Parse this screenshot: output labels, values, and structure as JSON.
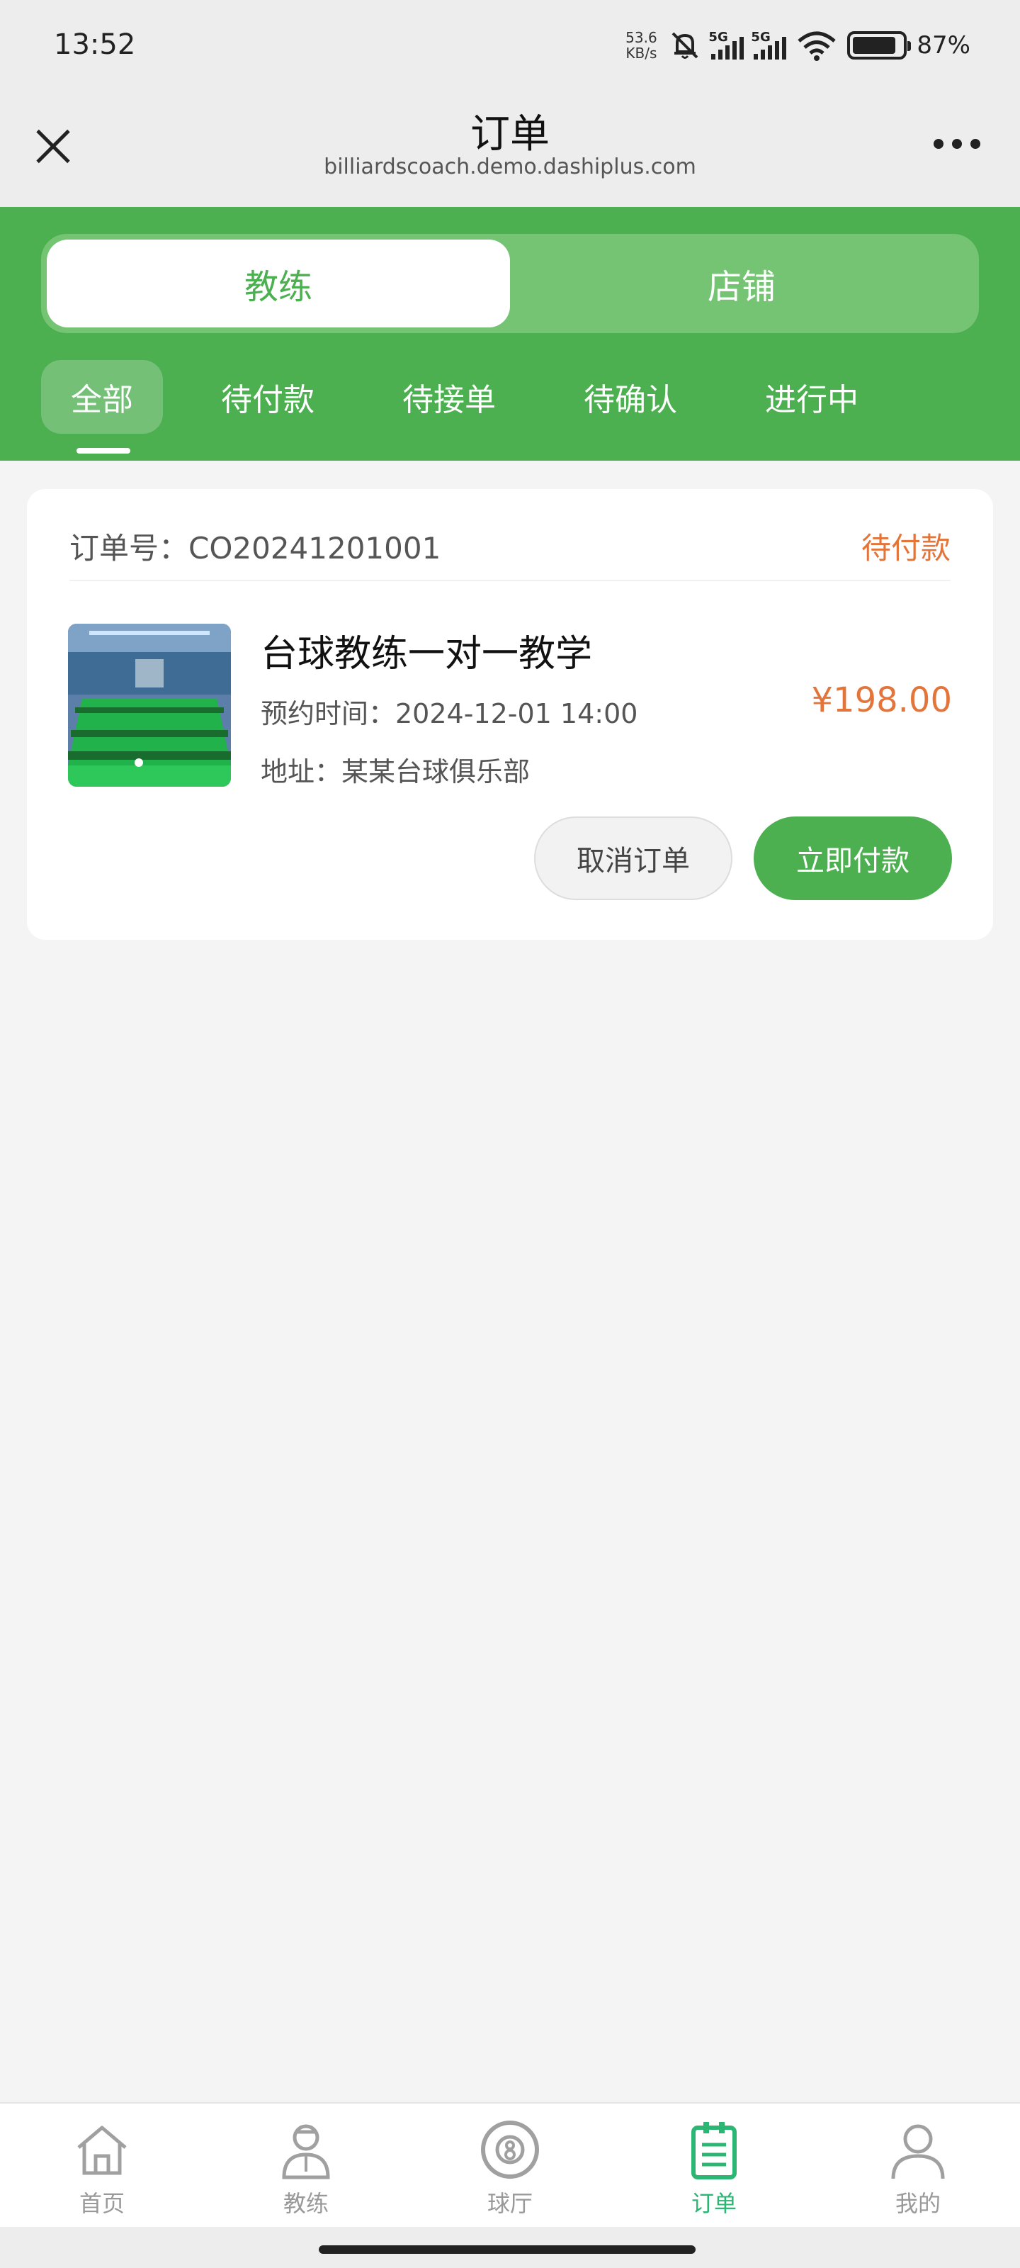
{
  "status_bar": {
    "time": "13:52",
    "net_speed_value": "53.6",
    "net_speed_unit": "KB/s",
    "signal1_tag": "5G",
    "signal2_tag": "5G",
    "battery_text": "87%",
    "battery_level": 0.87
  },
  "nav": {
    "title": "订单",
    "url": "billiardscoach.demo.dashiplus.com"
  },
  "segment": {
    "coach": "教练",
    "shop": "店铺"
  },
  "tabs": [
    "全部",
    "待付款",
    "待接单",
    "待确认",
    "进行中"
  ],
  "order": {
    "order_no": "订单号：CO20241201001",
    "status": "待付款",
    "title": "台球教练一对一教学",
    "time": "预约时间：2024-12-01 14:00",
    "address": "地址：某某台球俱乐部",
    "price": "¥198.00",
    "cancel_label": "取消订单",
    "pay_label": "立即付款"
  },
  "tabbar": {
    "home": "首页",
    "coach": "教练",
    "hall": "球厅",
    "orders": "订单",
    "mine": "我的"
  },
  "colors": {
    "brand_green": "#4caf50",
    "accent_orange": "#e4753a",
    "tab_active": "#2bb673"
  }
}
